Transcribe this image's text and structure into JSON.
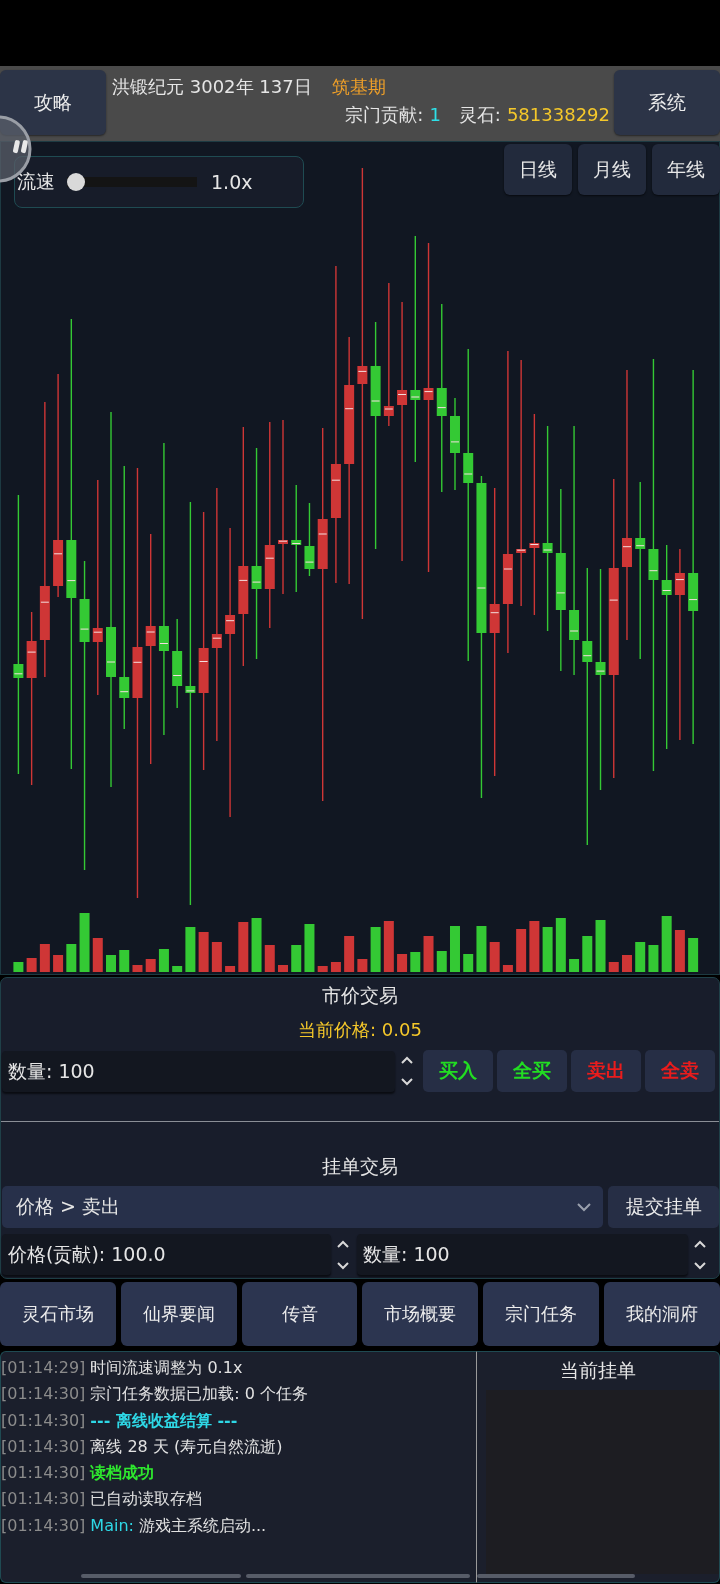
{
  "header": {
    "guide_button": "攻略",
    "date": "洪锻纪元 3002年 137日",
    "realm": "筑基期",
    "contribution": {
      "label": "宗门贡献:",
      "value": "1"
    },
    "spirit_stones": {
      "label": "灵石:",
      "value": "581338292"
    },
    "system_button": "系统"
  },
  "chart": {
    "speed": {
      "label": "流速",
      "level": 0,
      "reading": "1.0x"
    },
    "periods": [
      {
        "label": "日线"
      },
      {
        "label": "月线"
      },
      {
        "label": "年线"
      }
    ]
  },
  "market_trade": {
    "title": "市价交易",
    "price": "当前价格: 0.05",
    "quantity": {
      "value": "数量: 100"
    },
    "buttons": [
      {
        "label": "买入",
        "kind": "buy"
      },
      {
        "label": "全买",
        "kind": "buy"
      },
      {
        "label": "卖出",
        "kind": "sell"
      },
      {
        "label": "全卖",
        "kind": "sell"
      }
    ]
  },
  "order_trade": {
    "title": "挂单交易",
    "order_type": {
      "value": "价格 > 卖出"
    },
    "submit_button": "提交挂单",
    "price": {
      "value": "价格(贡献): 100.0"
    },
    "quantity": {
      "value": "数量: 100"
    }
  },
  "nav": [
    {
      "label": "灵石市场"
    },
    {
      "label": "仙界要闻"
    },
    {
      "label": "传音"
    },
    {
      "label": "市场概要"
    },
    {
      "label": "宗门任务"
    },
    {
      "label": "我的洞府"
    }
  ],
  "log": [
    {
      "time": "[01:14:29]",
      "text": "时间流速调整为 0.1x",
      "kind": "normal"
    },
    {
      "time": "[01:14:30]",
      "text": "宗门任务数据已加载: 0 个任务",
      "kind": "normal"
    },
    {
      "time": "[01:14:30]",
      "text": "--- 离线收益结算 ---",
      "kind": "notice"
    },
    {
      "time": "[01:14:30]",
      "text": "离线 28 天 (寿元自然流逝)",
      "kind": "normal"
    },
    {
      "time": "[01:14:30]",
      "text": "读档成功",
      "kind": "success"
    },
    {
      "time": "[01:14:30]",
      "text": "已自动读取存档",
      "kind": "normal"
    },
    {
      "time": "[01:14:30]",
      "source": "Main:",
      "text": "游戏主系统启动...",
      "kind": "normal"
    }
  ],
  "pending_orders": {
    "title": "当前挂单"
  }
}
